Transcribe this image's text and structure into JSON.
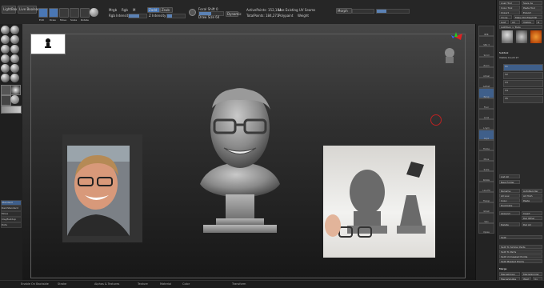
{
  "app": {
    "name": "ZBrush"
  },
  "toolbar": {
    "buttons": [
      "LightBox",
      "Live Boolean"
    ],
    "edit_label": "Edit",
    "draw_label": "Draw",
    "move_label": "Move",
    "scale_label": "Scale",
    "rotate_label": "Rotate",
    "mrgb_label": "Mrgb",
    "rgb_label": "Rgb",
    "m_label": "M",
    "zadd_label": "Zadd",
    "zsub_label": "Zsub",
    "rgb_intensity_label": "Rgb Intensity",
    "z_intensity_label": "Z Intensity 25",
    "focal_shift_label": "Focal Shift 0",
    "draw_size_label": "Draw Size 64",
    "dynamic_label": "Dynamic",
    "active_points_label": "ActivePoints: 152,184",
    "total_points_label": "TotalPoints: 184,271",
    "backface_label": "Use Existing UV Seams",
    "polypaint_label": "Polypaint",
    "weight_label": "Weight",
    "morph_label": "Morph"
  },
  "left_panel": {
    "items": [
      "Standard",
      "DamStandard",
      "Move",
      "ClayBuildup",
      "Dots"
    ],
    "colors": [
      "#888888",
      "#cccccc"
    ]
  },
  "right_toolbar": {
    "buttons": [
      "BPR",
      "SPix 3",
      "Scroll",
      "Zoom",
      "Actual",
      "AAHalf",
      "Persp",
      "Floor",
      "Local",
      "L.Sym",
      "Gxyz",
      "Frame",
      "Move",
      "Scale",
      "Rotate",
      "Line Fill",
      "Transp",
      "Ghost",
      "Solo",
      "Xpose"
    ]
  },
  "right_panel": {
    "top": [
      "Load Tool",
      "Save As",
      "Copy Tool",
      "Paste Tool",
      "Import",
      "Export",
      "Clone",
      "Make PolyMesh3D",
      "GoZ",
      "All",
      "Visible",
      "R",
      "Lightbox > Tools"
    ],
    "subtool_header": "Subtool",
    "subtool_items": [
      "Visible Count 27",
      "V1",
      "V2",
      "V3",
      "V4",
      "V5"
    ],
    "lower": [
      "List All",
      "New Folder",
      "Rename",
      "AutoReorder",
      "All Low",
      "All High",
      "Copy",
      "Paste",
      "Duplicate",
      "Append",
      "Insert",
      "Del Other",
      "Delete",
      "Del All",
      "Split",
      "Merge",
      "MergeDown",
      "MergeSimilar",
      "MergeVisible",
      "Weld",
      "Uv",
      "Remesh",
      "Project",
      "Extract",
      "Geometry",
      "Array Mesh",
      "NanoMesh"
    ],
    "bottom_items": [
      "Split To Similar Parts",
      "Split To Parts",
      "Split Unmasked Points",
      "Split Masked Points"
    ],
    "merge_items": [
      "MergeDown",
      "MergeSimilar",
      "MergeVisible",
      "Weld",
      "Uv"
    ]
  },
  "bottom_bar": {
    "items": [
      "Enable On Backside",
      "Stroke",
      "Alphas & Textures",
      "Texture",
      "Material",
      "Color",
      "Transform"
    ]
  },
  "viewport": {
    "reference_left_desc": "photo",
    "reference_right_desc": "photo"
  }
}
